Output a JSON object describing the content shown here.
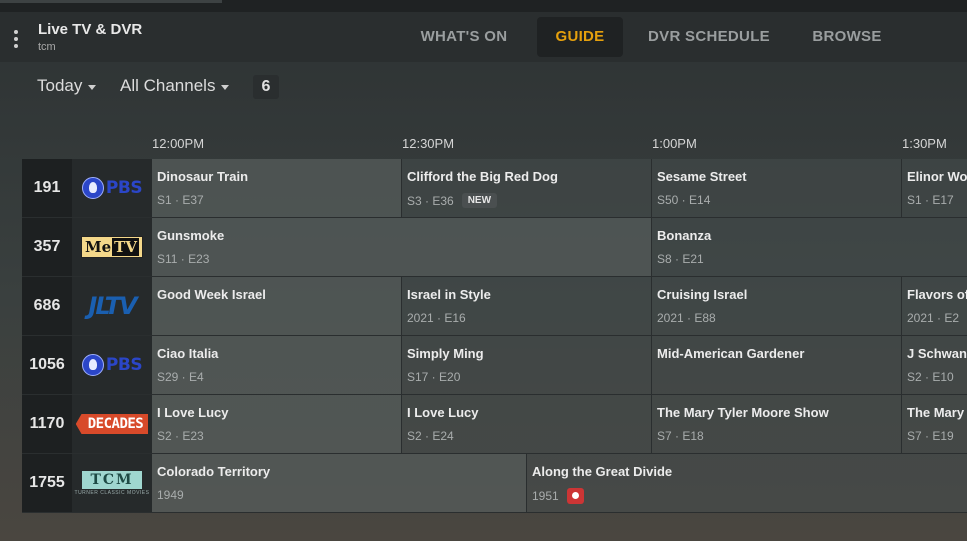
{
  "app": {
    "title": "Live TV & DVR",
    "subtitle": "tcm"
  },
  "nav": [
    {
      "label": "WHAT'S ON",
      "active": false
    },
    {
      "label": "GUIDE",
      "active": true
    },
    {
      "label": "DVR SCHEDULE",
      "active": false
    },
    {
      "label": "BROWSE",
      "active": false
    }
  ],
  "filters": {
    "day": "Today",
    "channels": "All Channels",
    "count": "6"
  },
  "times": [
    "12:00PM",
    "12:30PM",
    "1:00PM",
    "1:30PM"
  ],
  "colors": {
    "accent": "#e5a00d",
    "record": "#cc3535"
  },
  "channels": [
    {
      "number": "191",
      "logo": "PBS",
      "programs": [
        {
          "title": "Dinosaur Train",
          "meta": "S1 · E37"
        },
        {
          "title": "Clifford the Big Red Dog",
          "meta": "S3 · E36",
          "badge": "NEW"
        },
        {
          "title": "Sesame Street",
          "meta": "S50 · E14"
        },
        {
          "title": "Elinor Wo",
          "meta": "S1 · E17"
        }
      ]
    },
    {
      "number": "357",
      "logo": "MeTV",
      "programs": [
        {
          "title": "Gunsmoke",
          "meta": "S11 · E23"
        },
        {
          "title": "Bonanza",
          "meta": "S8 · E21"
        }
      ]
    },
    {
      "number": "686",
      "logo": "JLTV",
      "programs": [
        {
          "title": "Good Week Israel",
          "meta": ""
        },
        {
          "title": "Israel in Style",
          "meta": "2021 · E16"
        },
        {
          "title": "Cruising Israel",
          "meta": "2021 · E88"
        },
        {
          "title": "Flavors of",
          "meta": "2021 · E2"
        }
      ]
    },
    {
      "number": "1056",
      "logo": "PBS",
      "programs": [
        {
          "title": "Ciao Italia",
          "meta": "S29 · E4"
        },
        {
          "title": "Simply Ming",
          "meta": "S17 · E20"
        },
        {
          "title": "Mid-American Gardener",
          "meta": ""
        },
        {
          "title": "J Schwank",
          "meta": "S2 · E10"
        }
      ]
    },
    {
      "number": "1170",
      "logo": "DECADES",
      "programs": [
        {
          "title": "I Love Lucy",
          "meta": "S2 · E23"
        },
        {
          "title": "I Love Lucy",
          "meta": "S2 · E24"
        },
        {
          "title": "The Mary Tyler Moore Show",
          "meta": "S7 · E18"
        },
        {
          "title": "The Mary",
          "meta": "S7 · E19"
        }
      ]
    },
    {
      "number": "1755",
      "logo": "TCM",
      "logo_sub": "TURNER CLASSIC MOVIES",
      "programs": [
        {
          "title": "Colorado Territory",
          "meta": "1949"
        },
        {
          "title": "Along the Great Divide",
          "meta": "1951",
          "recording": true
        }
      ]
    }
  ]
}
